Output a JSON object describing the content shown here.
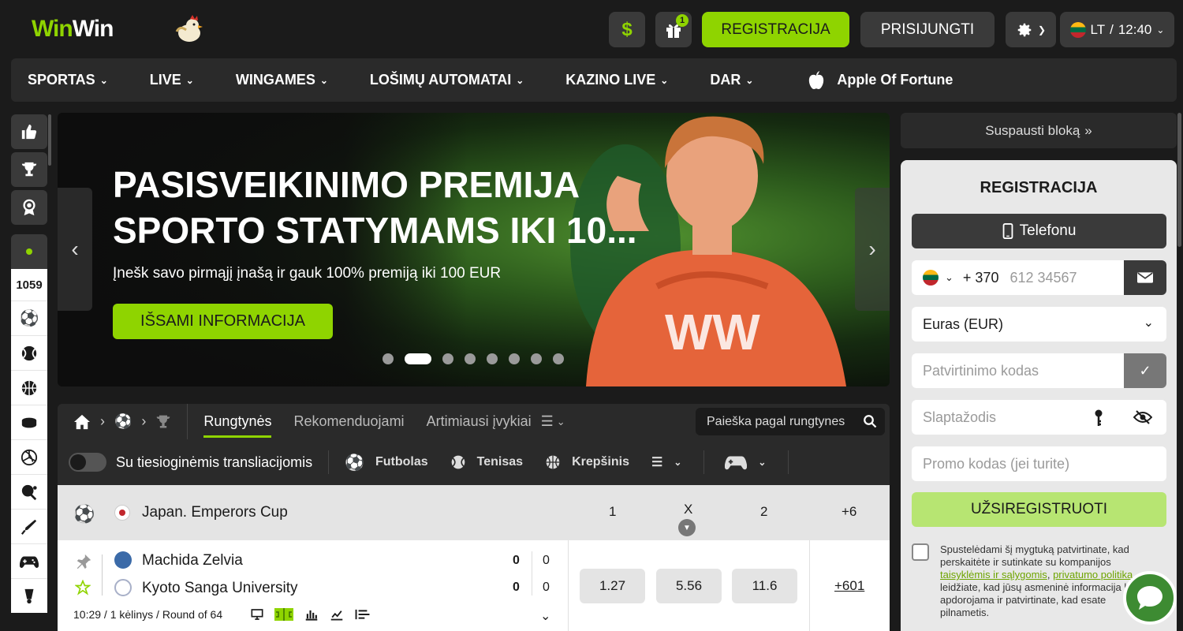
{
  "header": {
    "logo_part1": "Win",
    "logo_part2": "Win",
    "dollar_label": "$",
    "gift_badge": "1",
    "register_label": "REGISTRACIJA",
    "login_label": "PRISIJUNGTI",
    "lang_label": "LT",
    "time_separator": "/",
    "time": "12:40"
  },
  "nav": {
    "items": [
      {
        "label": "SPORTAS"
      },
      {
        "label": "LIVE"
      },
      {
        "label": "WINGAMES"
      },
      {
        "label": "LOŠIMŲ AUTOMATAI"
      },
      {
        "label": "KAZINO LIVE"
      },
      {
        "label": "DAR"
      }
    ],
    "promo_label": "Apple Of Fortune"
  },
  "rail": {
    "live_count": "1059"
  },
  "banner": {
    "title": "PASISVEIKINIMO PREMIJA SPORTO STATYMAMS IKI 10...",
    "subtitle": "Įnešk savo pirmąjį įnašą ir gauk 100% premiją iki 100 EUR",
    "cta": "IŠSAMI INFORMACIJA",
    "slide_count": 8,
    "active_slide": 2
  },
  "filters": {
    "tabs": [
      {
        "label": "Rungtynės",
        "active": true
      },
      {
        "label": "Rekomenduojami",
        "active": false
      },
      {
        "label": "Artimiausi įvykiai",
        "active": false
      }
    ],
    "search_placeholder": "Paieška pagal rungtynes",
    "stream_toggle_label": "Su tiesioginėmis transliacijomis",
    "sports": [
      {
        "label": "Futbolas",
        "icon": "soccer-ball-icon"
      },
      {
        "label": "Tenisas",
        "icon": "tennis-ball-icon"
      },
      {
        "label": "Krepšinis",
        "icon": "basketball-icon"
      }
    ]
  },
  "league": {
    "name": "Japan. Emperors Cup",
    "col1": "1",
    "colx": "X",
    "col2": "2",
    "more": "+6"
  },
  "match": {
    "team1": "Machida Zelvia",
    "team2": "Kyoto Sanga University",
    "team1_score": "0",
    "team1_score2": "0",
    "team2_score": "0",
    "team2_score2": "0",
    "meta": "10:29 / 1 kėlinys / Round of 64",
    "odds": [
      "1.27",
      "5.56",
      "11.6"
    ],
    "more_markets": "+601"
  },
  "registration": {
    "collapse_label": "Suspausti bloką",
    "title": "REGISTRACIJA",
    "phone_tab": "Telefonu",
    "phone_prefix": "+ 370",
    "phone_placeholder": "612 34567",
    "currency": "Euras (EUR)",
    "code_placeholder": "Patvirtinimo kodas",
    "password_placeholder": "Slaptažodis",
    "promo_placeholder": "Promo kodas (jei turite)",
    "submit": "UŽSIREGISTRUOTI",
    "terms_1": "Spustelėdami šį mygtuką patvirtinate, kad perskaitėte ir sutinkate su kompanijos",
    "terms_link1": "taisyklėmis ir sąlygomis",
    "terms_comma": ",",
    "terms_link2": "privatumo politika",
    "terms_2": "leidžiate, kad jūsų asmeninė informacija būtų apdorojama ir patvirtinate, kad esate pilnametis."
  },
  "colors": {
    "accent": "#8fd400",
    "background": "#1b1b1b",
    "panel": "#2a2a2a"
  }
}
